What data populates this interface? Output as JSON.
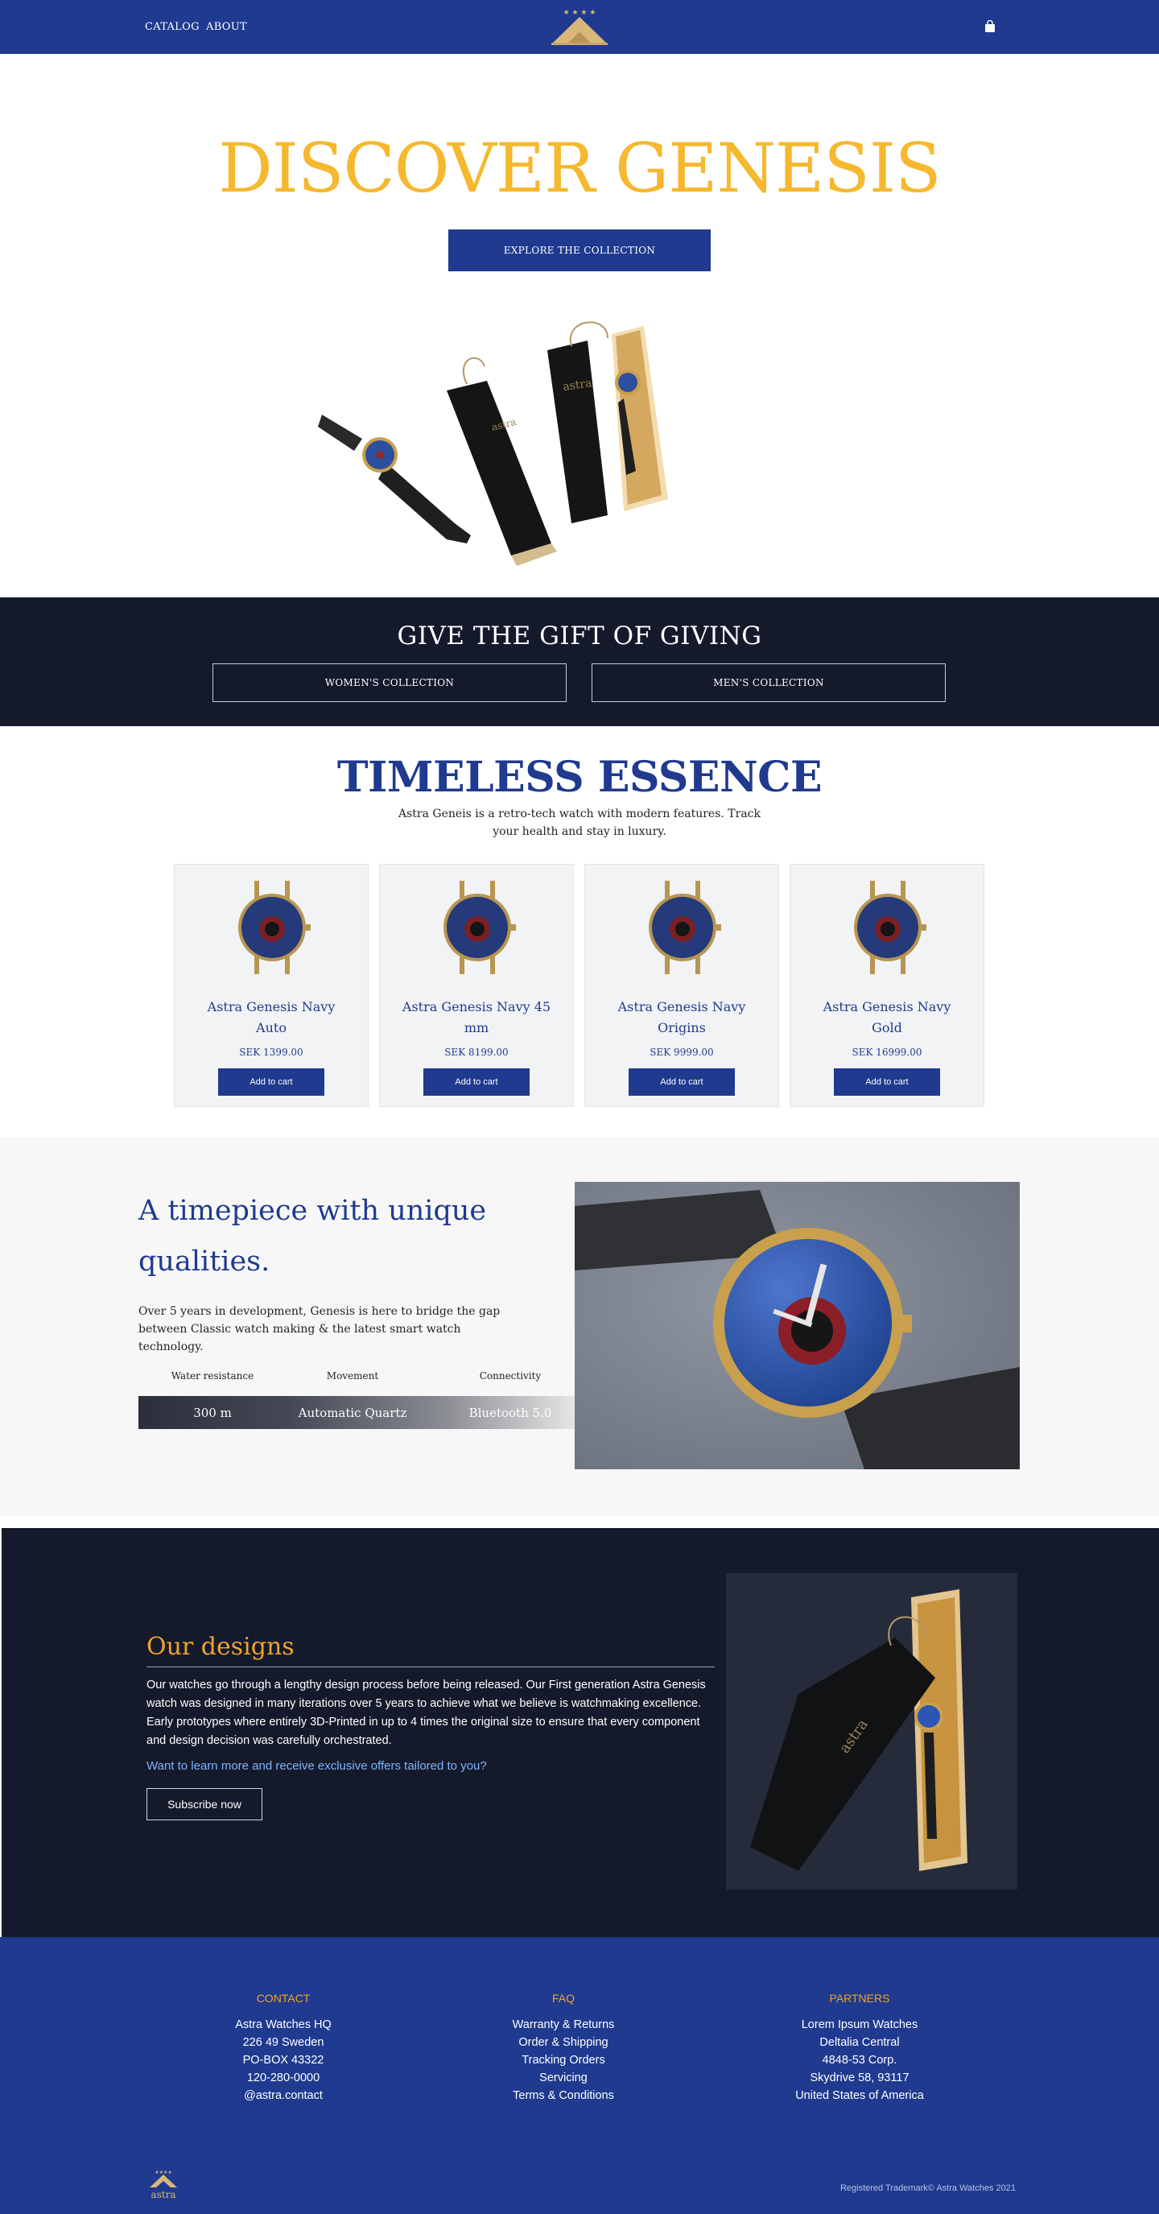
{
  "nav": {
    "links": [
      "CATALOG",
      "ABOUT"
    ],
    "logo": "astra-logo",
    "cart_icon": "shopping-bag-icon"
  },
  "hero": {
    "title": "DISCOVER GENESIS",
    "button": "EXPLORE THE COLLECTION",
    "image": "watches-with-boxes"
  },
  "gift": {
    "title": "GIVE THE GIFT OF GIVING",
    "buttons": [
      "WOMEN'S COLLECTION",
      "MEN'S COLLECTION"
    ]
  },
  "timeless": {
    "title": "TIMELESS ESSENCE",
    "description": "Astra Geneis is a retro-tech watch with modern features. Track your health and stay in luxury.",
    "products": [
      {
        "name": "Astra Genesis Navy Auto",
        "price": "SEK 1399.00",
        "button": "Add to cart"
      },
      {
        "name": "Astra Genesis Navy 45 mm",
        "price": "SEK 8199.00",
        "button": "Add to cart"
      },
      {
        "name": "Astra Genesis Navy Origins",
        "price": "SEK 9999.00",
        "button": "Add to cart"
      },
      {
        "name": "Astra Genesis Navy Gold",
        "price": "SEK 16999.00",
        "button": "Add to cart"
      }
    ]
  },
  "unique": {
    "title": "A timepiece with unique qualities.",
    "description": "Over 5 years in development, Genesis is here to bridge the gap between Classic watch making & the latest smart watch technology.",
    "specs": [
      {
        "label": "Water resistance",
        "value": "300 m"
      },
      {
        "label": "Movement",
        "value": "Automatic Quartz"
      },
      {
        "label": "Connectivity",
        "value": "Bluetooth 5.0"
      }
    ],
    "image": "watch-on-stone"
  },
  "designs": {
    "title": "Our designs",
    "body": "Our watches go through a lengthy design process before being released. Our First generation Astra Genesis watch was designed in many iterations over 5 years to achieve what we believe is watchmaking excellence. Early prototypes where entirely 3D-Printed in up to 4 times the original size to ensure that every component and design decision was carefully orchestrated.",
    "cta": "Want to learn more and receive exclusive offers tailored to you?",
    "button": "Subscribe now",
    "image": "watch-box-dark"
  },
  "footer": {
    "columns": [
      {
        "heading": "CONTACT",
        "lines": [
          "Astra Watches HQ",
          "226 49 Sweden",
          "PO-BOX 43322",
          "120-280-0000",
          "@astra.contact"
        ]
      },
      {
        "heading": "FAQ",
        "lines": [
          "Warranty & Returns",
          "Order & Shipping",
          "Tracking Orders",
          "Servicing",
          "Terms & Conditions"
        ]
      },
      {
        "heading": "PARTNERS",
        "lines": [
          "Lorem Ipsum Watches",
          "Deltalia Central",
          "4848-53 Corp.",
          "Skydrive 58, 93117",
          "United States of America"
        ]
      }
    ],
    "copyright": "Registered Trademark© Astra Watches 2021"
  },
  "colors": {
    "brand_blue": "#1f3a8f",
    "gold": "#f5b82e",
    "orange": "#f0a330",
    "dark": "#141a2b"
  }
}
